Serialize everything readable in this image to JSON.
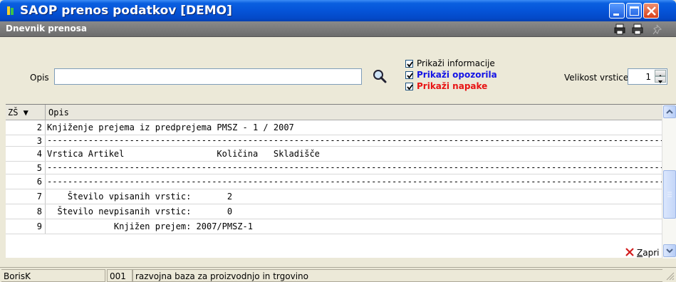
{
  "window": {
    "title": "SAOP prenos podatkov [DEMO]"
  },
  "panel": {
    "title": "Dnevnik prenosa",
    "toolbar": [
      {
        "icon": "print-setup-icon"
      },
      {
        "icon": "print-icon"
      },
      {
        "icon": "pin-icon"
      }
    ]
  },
  "filter": {
    "opis_label": "Opis",
    "opis_value": "",
    "search_icon": "magnifier-icon",
    "checkboxes": [
      {
        "label": "Prikaži informacije",
        "checked": true,
        "color": "#000000"
      },
      {
        "label": "Prikaži opozorila",
        "checked": true,
        "color": "#1414e6"
      },
      {
        "label": "Prikaži napake",
        "checked": true,
        "color": "#e81414"
      }
    ],
    "velikost_label": "Velikost vrstice",
    "velikost_value": "1"
  },
  "grid": {
    "columns": [
      "ZŠ ▼",
      "Opis"
    ],
    "rows": [
      {
        "num": "2",
        "text": "Knjiženje prejema iz predprejema PMSZ - 1 / 2007"
      },
      {
        "num": "3",
        "text": "--------------------------------------------------------------------------------------------------------------------------"
      },
      {
        "num": "4",
        "text": "Vrstica Artikel                  Količina   Skladišče"
      },
      {
        "num": "5",
        "text": "--------------------------------------------------------------------------------------------------------------------------"
      },
      {
        "num": "6",
        "text": "--------------------------------------------------------------------------------------------------------------------------"
      },
      {
        "num": "7",
        "text": "    Število vpisanih vrstic:       2"
      },
      {
        "num": "8",
        "text": "  Število nevpisanih vrstic:       0"
      },
      {
        "num": "9",
        "text": "             Knjižen prejem: 2007/PMSZ-1"
      }
    ]
  },
  "actions": {
    "close_label_first": "Z",
    "close_label_rest": "apri"
  },
  "status": {
    "user": "BorisK",
    "code": "001",
    "db": "razvojna baza za proizvodnjo in trgovino"
  },
  "colors": {
    "title_bar": "#0554d8",
    "panel_bar": "#7a7a7a",
    "window_bg": "#ece9d8"
  }
}
